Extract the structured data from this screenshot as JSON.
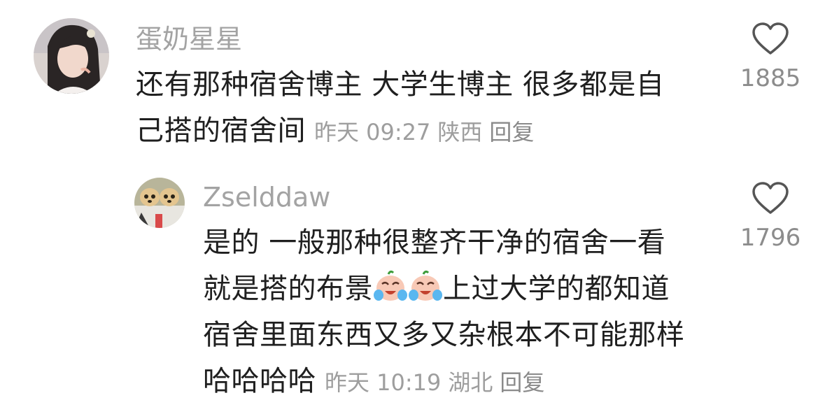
{
  "comments": [
    {
      "username": "蛋奶星星",
      "lines": [
        "还有那种宿舍博主 大学生博主 很多都是自",
        "己搭的宿舍间"
      ],
      "time": "昨天 09:27",
      "location": "陕西",
      "reply_label": "回复",
      "likes": "1885",
      "avatar_icon": "profile-photo-girl"
    },
    {
      "username": "Zselddaw",
      "lines": [
        "是的 一般那种很整齐干净的宿舍一看",
        "就是搭的布景",
        "上过大学的都知道",
        "宿舍里面东西又多又杂根本不可能那样",
        "哈哈哈哈"
      ],
      "time": "昨天 10:19",
      "location": "湖北",
      "reply_label": "回复",
      "likes": "1796",
      "avatar_icon": "profile-photo-dogs",
      "emoji_icon": "crying-laughing-sticker"
    }
  ]
}
